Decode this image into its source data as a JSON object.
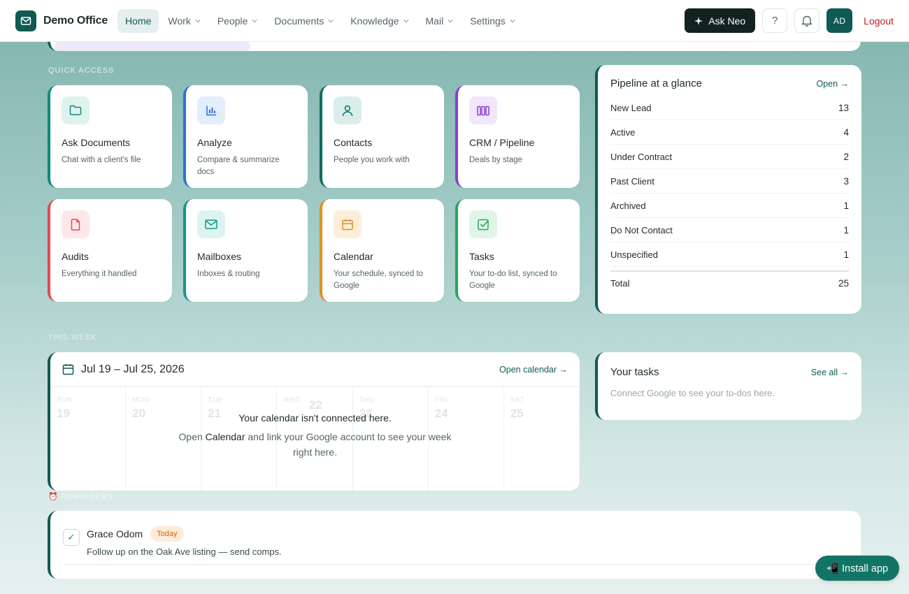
{
  "brand": {
    "name": "Demo Office"
  },
  "nav": {
    "items": [
      {
        "label": "Home",
        "active": true,
        "dropdown": false
      },
      {
        "label": "Work",
        "active": false,
        "dropdown": true
      },
      {
        "label": "People",
        "active": false,
        "dropdown": true
      },
      {
        "label": "Documents",
        "active": false,
        "dropdown": true
      },
      {
        "label": "Knowledge",
        "active": false,
        "dropdown": true
      },
      {
        "label": "Mail",
        "active": false,
        "dropdown": true
      },
      {
        "label": "Settings",
        "active": false,
        "dropdown": true
      }
    ]
  },
  "header": {
    "ask_label": "Ask Neo",
    "help_label": "?",
    "avatar_initials": "AD",
    "logout_label": "Logout"
  },
  "quick_access": {
    "label": "QUICK ACCESS",
    "tiles": [
      {
        "title": "Ask Documents",
        "subtitle": "Chat with a client's file",
        "icon": "folder-icon",
        "accent": "#0f8a7a",
        "icon_bg": "#dff3ee"
      },
      {
        "title": "Analyze",
        "subtitle": "Compare & summarize docs",
        "icon": "bar-chart-icon",
        "accent": "#2f6fd6",
        "icon_bg": "#e3eefc"
      },
      {
        "title": "Contacts",
        "subtitle": "People you work with",
        "icon": "person-icon",
        "accent": "#0f6b62",
        "icon_bg": "#d9eeeb"
      },
      {
        "title": "CRM / Pipeline",
        "subtitle": "Deals by stage",
        "icon": "columns-icon",
        "accent": "#8a3fcf",
        "icon_bg": "#f1e6fb"
      },
      {
        "title": "Audits",
        "subtitle": "Everything it handled",
        "icon": "document-icon",
        "accent": "#e04a55",
        "icon_bg": "#fde7e8"
      },
      {
        "title": "Mailboxes",
        "subtitle": "Inboxes & routing",
        "icon": "mail-icon",
        "accent": "#11968a",
        "icon_bg": "#ddf3f1"
      },
      {
        "title": "Calendar",
        "subtitle": "Your schedule, synced to Google",
        "icon": "calendar-icon",
        "accent": "#e0901d",
        "icon_bg": "#fdeedb"
      },
      {
        "title": "Tasks",
        "subtitle": "Your to-do list, synced to Google",
        "icon": "checkbox-icon",
        "accent": "#2aa35a",
        "icon_bg": "#e0f4e7"
      }
    ]
  },
  "pipeline": {
    "title": "Pipeline at a glance",
    "open_label": "Open →",
    "rows": [
      {
        "label": "New Lead",
        "value": "13"
      },
      {
        "label": "Active",
        "value": "4"
      },
      {
        "label": "Under Contract",
        "value": "2"
      },
      {
        "label": "Past Client",
        "value": "3"
      },
      {
        "label": "Archived",
        "value": "1"
      },
      {
        "label": "Do Not Contact",
        "value": "1"
      },
      {
        "label": "Unspecified",
        "value": "1"
      }
    ],
    "total_label": "Total",
    "total_value": "25"
  },
  "this_week": {
    "label": "THIS WEEK",
    "range": "Jul 19 – Jul 25, 2026",
    "open_calendar_label": "Open calendar →",
    "days": [
      {
        "day": "SUN",
        "num": "19"
      },
      {
        "day": "MON",
        "num": "20"
      },
      {
        "day": "TUE",
        "num": "21"
      },
      {
        "day": "WED",
        "num": ""
      },
      {
        "day": "THU",
        "num": "23"
      },
      {
        "day": "FRI",
        "num": "24"
      },
      {
        "day": "SAT",
        "num": "25"
      }
    ],
    "today_num": "22",
    "not_connected": "Your calendar isn't connected here.",
    "help_pre": "Open ",
    "help_link": "Calendar",
    "help_post": " and link your Google account to see your week right here."
  },
  "tasks": {
    "title": "Your tasks",
    "see_all_label": "See all →",
    "empty_text": "Connect Google to see your to-dos here."
  },
  "reminders": {
    "label": "⏰ REMINDERS",
    "items": [
      {
        "name": "Grace Odom",
        "badge": "Today",
        "note": "Follow up on the Oak Ave listing — send comps."
      }
    ]
  },
  "install": {
    "label": "📲 Install app"
  }
}
